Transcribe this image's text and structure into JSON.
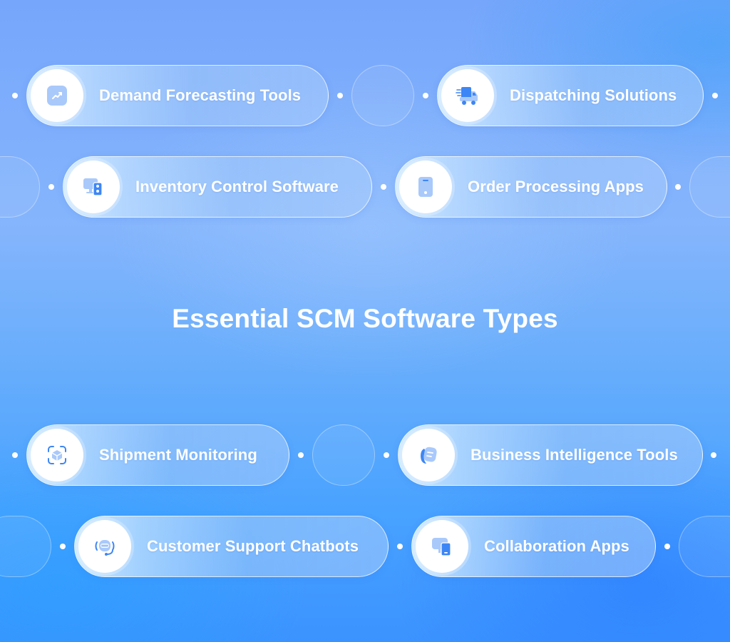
{
  "title": "Essential SCM Software Types",
  "colors": {
    "icon_primary": "#3d86f5",
    "icon_light": "#a9c9fb",
    "text": "#ffffff"
  },
  "items": [
    {
      "label": "Demand Forecasting Tools",
      "icon": "trend-chart-icon"
    },
    {
      "label": "Dispatching Solutions",
      "icon": "delivery-truck-icon"
    },
    {
      "label": "Inventory Control Software",
      "icon": "monitor-server-icon"
    },
    {
      "label": "Order Processing Apps",
      "icon": "mobile-phone-icon"
    },
    {
      "label": "Shipment Monitoring",
      "icon": "package-scan-icon"
    },
    {
      "label": "Business Intelligence Tools",
      "icon": "document-cards-icon"
    },
    {
      "label": "Customer Support Chatbots",
      "icon": "chatbot-headset-icon"
    },
    {
      "label": "Collaboration Apps",
      "icon": "devices-icon"
    }
  ]
}
